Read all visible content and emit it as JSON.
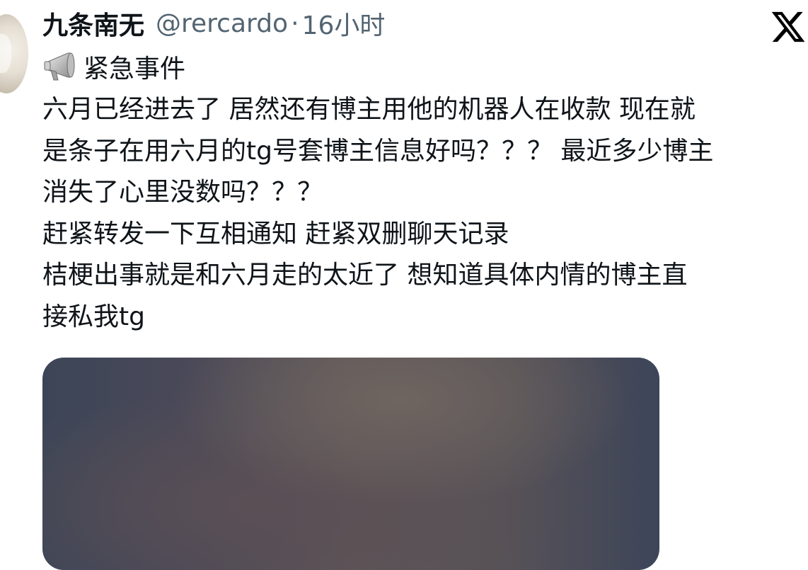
{
  "tweet": {
    "display_name": "九条南无",
    "handle": "@rercardo",
    "separator": "·",
    "time": "16小时",
    "emoji_icon": "megaphone-icon",
    "emoji_text": "紧急事件",
    "lines": [
      "六月已经进去了 居然还有博主用他的机器人在收款 现在就",
      "是条子在用六月的tg号套博主信息好吗？？？ 最近多少博主",
      "消失了心里没数吗？？？",
      "赶紧转发一下互相通知 赶紧双删聊天记录",
      "桔梗出事就是和六月走的太近了 想知道具体内情的博主直",
      "接私我tg"
    ]
  },
  "app": {
    "logo_icon": "x-logo-icon"
  },
  "colors": {
    "text": "#0f1419",
    "secondary_text": "#536471"
  }
}
